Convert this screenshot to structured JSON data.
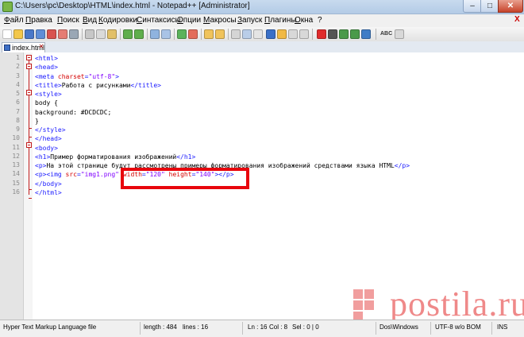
{
  "window": {
    "title": "C:\\Users\\pc\\Desktop\\HTML\\index.html - Notepad++ [Administrator]",
    "min_label": "–",
    "max_label": "□",
    "close_label": "✕"
  },
  "menu": {
    "items": [
      "Файл",
      "Правка",
      "Поиск",
      "Вид",
      "Кодировки",
      "Синтаксисы",
      "Опции",
      "Макросы",
      "Запуск",
      "Плагины",
      "Окна",
      "?"
    ],
    "close_label": "X"
  },
  "toolbar": {
    "spellcheck_label": "ABC"
  },
  "tab": {
    "label": "index.html",
    "close_label": "✕"
  },
  "editor": {
    "line_numbers": [
      "1",
      "2",
      "3",
      "4",
      "5",
      "6",
      "7",
      "8",
      "9",
      "10",
      "11",
      "12",
      "13",
      "14",
      "15",
      "16"
    ],
    "lines": [
      [
        [
          "tag",
          "<html>"
        ]
      ],
      [
        [
          "tag",
          "<head>"
        ]
      ],
      [
        [
          "tag",
          "<meta "
        ],
        [
          "attr",
          "charset"
        ],
        [
          "tag",
          "="
        ],
        [
          "val",
          "\"utf-8\""
        ],
        [
          "tag",
          ">"
        ]
      ],
      [
        [
          "tag",
          "<title>"
        ],
        [
          "txt",
          "Работа с рисунками"
        ],
        [
          "tag",
          "</title>"
        ]
      ],
      [
        [
          "tag",
          "<style>"
        ]
      ],
      [
        [
          "css",
          "body {"
        ]
      ],
      [
        [
          "css",
          "background: #DCDCDC;"
        ]
      ],
      [
        [
          "css",
          "}"
        ]
      ],
      [
        [
          "tag",
          "</style>"
        ]
      ],
      [
        [
          "tag",
          "</head>"
        ]
      ],
      [
        [
          "tag",
          "<body>"
        ]
      ],
      [
        [
          "tag",
          "<h1>"
        ],
        [
          "txt",
          "Пример форматирования изображений"
        ],
        [
          "tag",
          "</h1>"
        ]
      ],
      [
        [
          "tag",
          "<p>"
        ],
        [
          "txt",
          "На этой странице будут рассмотрены примеры форматирования изображений средствами языка HTML"
        ],
        [
          "tag",
          "</p>"
        ]
      ],
      [
        [
          "tag",
          "<p><img "
        ],
        [
          "attr",
          "src"
        ],
        [
          "tag",
          "="
        ],
        [
          "val",
          "\"img1.png\""
        ],
        [
          "tag",
          " "
        ],
        [
          "attr",
          "width"
        ],
        [
          "tag",
          "="
        ],
        [
          "val",
          "\"120\""
        ],
        [
          "tag",
          " "
        ],
        [
          "attr",
          "height"
        ],
        [
          "tag",
          "="
        ],
        [
          "val",
          "\"140\""
        ],
        [
          "tag",
          "></p>"
        ]
      ],
      [
        [
          "tag",
          "</body>"
        ]
      ],
      [
        [
          "tag",
          "</html>"
        ]
      ]
    ]
  },
  "watermark": {
    "text": "postila.ru",
    "color": "#e12828"
  },
  "status": {
    "filetype": "Hyper Text Markup Language file",
    "length": "length : 484",
    "lines": "lines : 16",
    "ln": "Ln : 16",
    "col": "Col : 8",
    "sel": "Sel : 0 | 0",
    "eol": "Dos\\Windows",
    "encoding": "UTF-8 w/o BOM",
    "mode": "INS"
  },
  "colors": {
    "highlight_box": "#e8060d",
    "tag": "#1a1aff",
    "attribute": "#d40000",
    "value": "#8000ff"
  }
}
